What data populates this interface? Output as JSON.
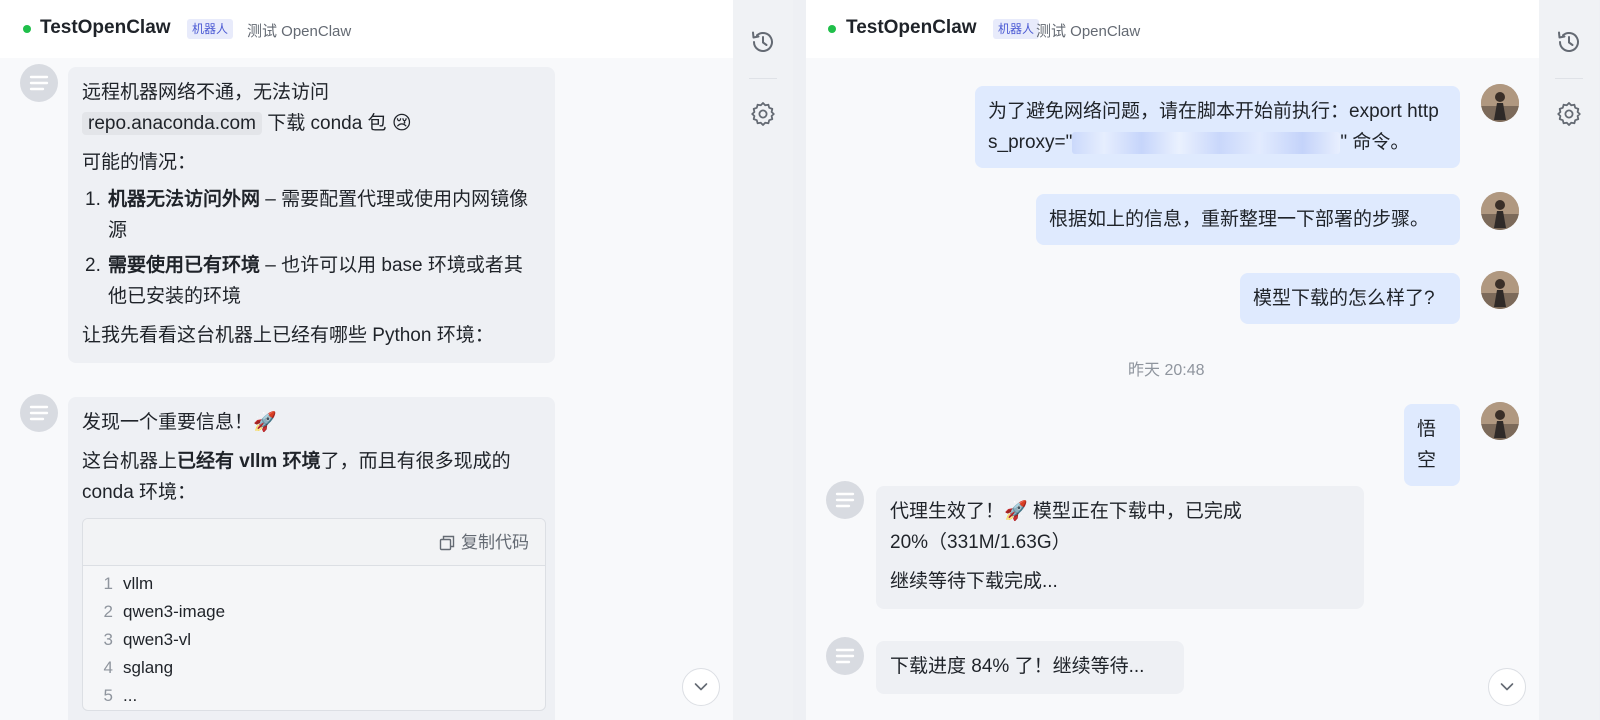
{
  "colors": {
    "accent": "#4c5bd4",
    "online": "#1fbf4a",
    "user_bubble": "#dfeafe",
    "bot_bubble": "#eef0f4"
  },
  "left_panel": {
    "header": {
      "title": "TestOpenClaw",
      "tag": "机器人",
      "subtitle": "测试 OpenClaw"
    },
    "messages": [
      {
        "line1": "远程机器网络不通，无法访问",
        "code": "repo.anaconda.com",
        "line2": " 下载 conda 包 😢",
        "intro": "可能的情况：",
        "items": [
          {
            "num": "1.",
            "bold": "机器无法访问外网",
            "text": " – 需要配置代理或使用内网镜像源"
          },
          {
            "num": "2.",
            "bold": "需要使用已有环境",
            "text": " – 也许可以用 base 环境或者其他已安装的环境"
          }
        ],
        "outro": "让我先看看这台机器上已经有哪些 Python 环境："
      },
      {
        "line1": "发现一个重要信息！🚀",
        "p2_pre": "这台机器上",
        "p2_bold": "已经有 vllm 环境",
        "p2_post": "了，而且有很多现成的conda 环境：",
        "copy_label": "复制代码",
        "code_lines": [
          {
            "n": "1",
            "t": "vllm"
          },
          {
            "n": "2",
            "t": "qwen3-image"
          },
          {
            "n": "3",
            "t": "qwen3-vl"
          },
          {
            "n": "4",
            "t": "sglang"
          },
          {
            "n": "5",
            "t": "..."
          }
        ]
      }
    ]
  },
  "right_panel": {
    "header": {
      "title": "TestOpenClaw",
      "tag": "机器人",
      "subtitle": "测试 OpenClaw"
    },
    "user_messages": [
      {
        "pre": "为了避免网络问题，请在脚本开始前执行：export https_proxy=\"",
        "post": "\" 命令。"
      },
      {
        "text": "根据如上的信息，重新整理一下部署的步骤。"
      },
      {
        "text": "模型下载的怎么样了?"
      },
      {
        "text": "悟空"
      }
    ],
    "timestamp": "昨天 20:48",
    "bot_messages": [
      {
        "line1": "代理生效了！🚀 模型正在下载中，已完成20%（331M/1.63G）",
        "line2": "继续等待下载完成..."
      },
      {
        "line1": "下载进度 84% 了！继续等待..."
      }
    ]
  },
  "icons": [
    "history-icon",
    "settings-icon",
    "chevron-down-icon",
    "copy-icon",
    "bot-avatar-icon"
  ]
}
